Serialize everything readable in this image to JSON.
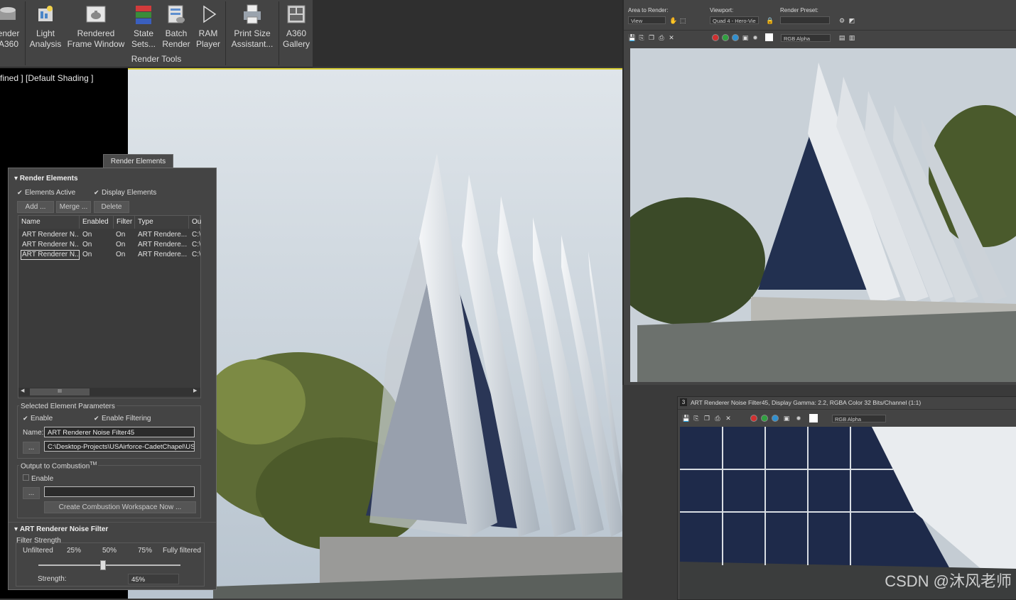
{
  "ribbon": {
    "buttons": [
      {
        "line1": "ender",
        "line2": "A360",
        "icon": "render-a360-icon"
      },
      {
        "line1": "Light",
        "line2": "Analysis",
        "icon": "light-analysis-icon"
      },
      {
        "line1": "Rendered",
        "line2": "Frame Window",
        "icon": "teapot-icon"
      },
      {
        "line1": "State",
        "line2": "Sets...",
        "icon": "state-sets-icon"
      },
      {
        "line1": "Batch",
        "line2": "Render",
        "icon": "batch-render-icon"
      },
      {
        "line1": "RAM",
        "line2": "Player",
        "icon": "play-icon"
      },
      {
        "line1": "Print Size",
        "line2": "Assistant...",
        "icon": "printer-icon"
      },
      {
        "line1": "A360",
        "line2": "Gallery",
        "icon": "gallery-icon"
      }
    ],
    "group_label": "Render Tools"
  },
  "viewport": {
    "label": "fined ] [Default Shading ]"
  },
  "render_elements": {
    "tab_label": "Render Elements",
    "section_title": "Render Elements",
    "elements_active": "Elements Active",
    "display_elements": "Display Elements",
    "add": "Add ...",
    "merge": "Merge ...",
    "delete": "Delete",
    "columns": [
      "Name",
      "Enabled",
      "Filter",
      "Type",
      "Ou"
    ],
    "rows": [
      [
        "ART Renderer N...",
        "On",
        "On",
        "ART Rendere...",
        "C:\\"
      ],
      [
        "ART Renderer N...",
        "On",
        "On",
        "ART Rendere...",
        "C:\\"
      ],
      [
        "ART Renderer N...",
        "On",
        "On",
        "ART Rendere...",
        "C:\\"
      ]
    ],
    "scroll_thumb": "III",
    "selected_params": {
      "title": "Selected Element Parameters",
      "enable": "Enable",
      "enable_filtering": "Enable Filtering",
      "name_label": "Name:",
      "name_value": "ART Renderer Noise Filter45",
      "browse": "...",
      "path_value": "C:\\Desktop-Projects\\USAirforce-CadetChapel\\USA"
    },
    "combustion": {
      "title": "Output to Combustion",
      "tm": "TM",
      "enable": "Enable",
      "browse": "...",
      "create_button": "Create Combustion Workspace Now ..."
    },
    "noise_filter": {
      "title": "ART Renderer Noise Filter",
      "strength_label": "Filter Strength",
      "ticks": [
        "Unfiltered",
        "25%",
        "50%",
        "75%",
        "Fully filtered"
      ],
      "slider_value": 0.45,
      "strength_field_label": "Strength:",
      "strength_value": "45%"
    }
  },
  "render_window": {
    "area_to_render_label": "Area to Render:",
    "area_value": "View",
    "viewport_label": "Viewport:",
    "viewport_value": "Quad 4 - Hero-Vie",
    "preset_label": "Render Preset:",
    "preset_value": "",
    "channel_value": "RGB Alpha"
  },
  "render_window2": {
    "badge": "3",
    "title": "ART Renderer Noise Filter45, Display Gamma: 2.2, RGBA Color 32 Bits/Channel (1:1)",
    "channel_value": "RGB Alpha"
  },
  "watermark": "CSDN @沐风老师",
  "colors": {
    "accent_yellow": "#d9cf35",
    "panel_bg": "#444444"
  }
}
